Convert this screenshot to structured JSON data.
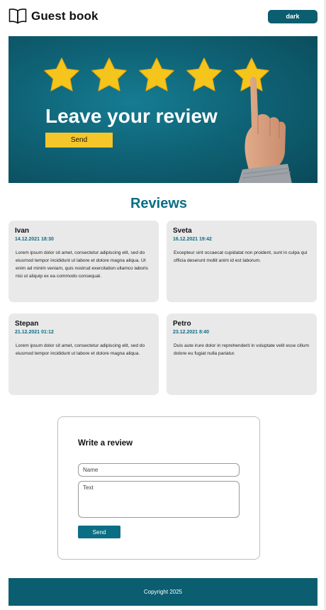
{
  "header": {
    "title": "Guest book",
    "logo_icon": "open-book-icon",
    "theme_toggle_label": "dark"
  },
  "hero": {
    "title": "Leave your review",
    "button_label": "Send",
    "star_count": 5,
    "colors": {
      "background": "#0f6376",
      "star": "#f6c51b",
      "button": "#f5c62a"
    }
  },
  "reviews": {
    "heading": "Reviews",
    "items": [
      {
        "author": "Ivan",
        "date": "14.12.2021 18:30",
        "text": "Lorem ipsum dolor sit amet, consectetur adipiscing elit, sed do eiusmod tempor incididunt ut labore et dolore magna aliqua. Ut enim ad minim veniam, quis nostrud exercitation ullamco laboris nisi ut aliquip ex ea commodo consequat."
      },
      {
        "author": "Sveta",
        "date": "16.12.2021 19:42",
        "text": "Excepteur sint occaecat cupidatat non proident, sunt in culpa qui officia deserunt mollit anim id est laborum."
      },
      {
        "author": "Stepan",
        "date": "21.12.2021 01:12",
        "text": "Lorem ipsum dolor sit amet, consectetur adipiscing elit, sed do eiusmod tempor incididunt ut labore et dolore magna aliqua."
      },
      {
        "author": "Petro",
        "date": "23.12.2021 8:40",
        "text": "Duis aute irure dolor in reprehenderit in voluptate velit esse cillum dolore eu fugiat nulla pariatur."
      }
    ]
  },
  "form": {
    "title": "Write a review",
    "name_placeholder": "Name",
    "text_placeholder": "Text",
    "submit_label": "Send"
  },
  "footer": {
    "text": "Copyright 2025"
  },
  "colors": {
    "accent": "#0b6e84",
    "footer": "#0b5d70",
    "card": "#e9e9e9"
  }
}
